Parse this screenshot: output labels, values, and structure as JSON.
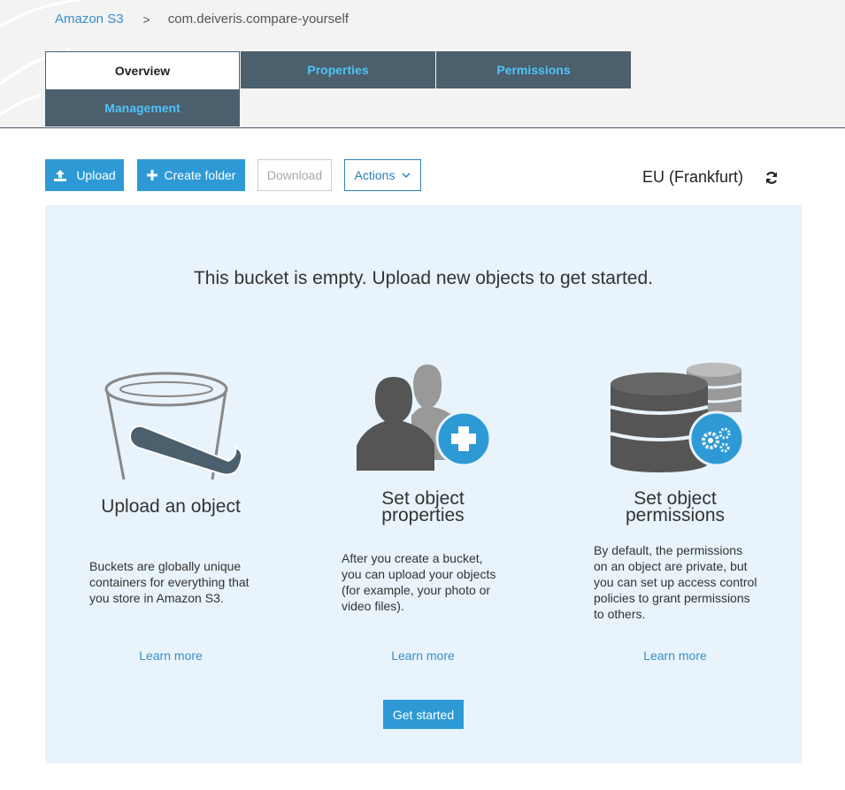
{
  "breadcrumb": {
    "root": "Amazon S3",
    "separator": ">",
    "current": "com.deiveris.compare-yourself"
  },
  "tabs": [
    {
      "label": "Overview",
      "active": true
    },
    {
      "label": "Properties",
      "active": false
    },
    {
      "label": "Permissions",
      "active": false
    },
    {
      "label": "Management",
      "active": false
    }
  ],
  "toolbar": {
    "upload_label": "Upload",
    "create_folder_label": "Create folder",
    "download_label": "Download",
    "actions_label": "Actions",
    "region": "EU (Frankfurt)"
  },
  "main": {
    "empty_message": "This bucket is empty. Upload new objects to get started.",
    "columns": [
      {
        "title": "Upload an object",
        "description_lines": [
          "Buckets are globally unique",
          "containers for everything that",
          "you store in Amazon S3."
        ],
        "link": "Learn more",
        "icon": "bucket-icon"
      },
      {
        "title_lines": [
          "Set object",
          "properties"
        ],
        "description_lines": [
          "After you create a bucket,",
          "you can upload your objects",
          "(for example, your photo or",
          "video files)."
        ],
        "link": "Learn more",
        "icon": "users-add-icon"
      },
      {
        "title_lines": [
          "Set object",
          "permissions"
        ],
        "description_lines": [
          "By default, the permissions",
          "on an object are private, but",
          "you can set up access control",
          "policies to grant permissions",
          "to others."
        ],
        "link": "Learn more",
        "icon": "database-settings-icon"
      }
    ],
    "get_started_label": "Get started"
  },
  "colors": {
    "accent": "#2d9ad6",
    "tab_dark": "#4b5f6d",
    "tab_text": "#4fc3f7",
    "panel_bg": "#e8f3fb",
    "link": "#3a8fc8"
  }
}
